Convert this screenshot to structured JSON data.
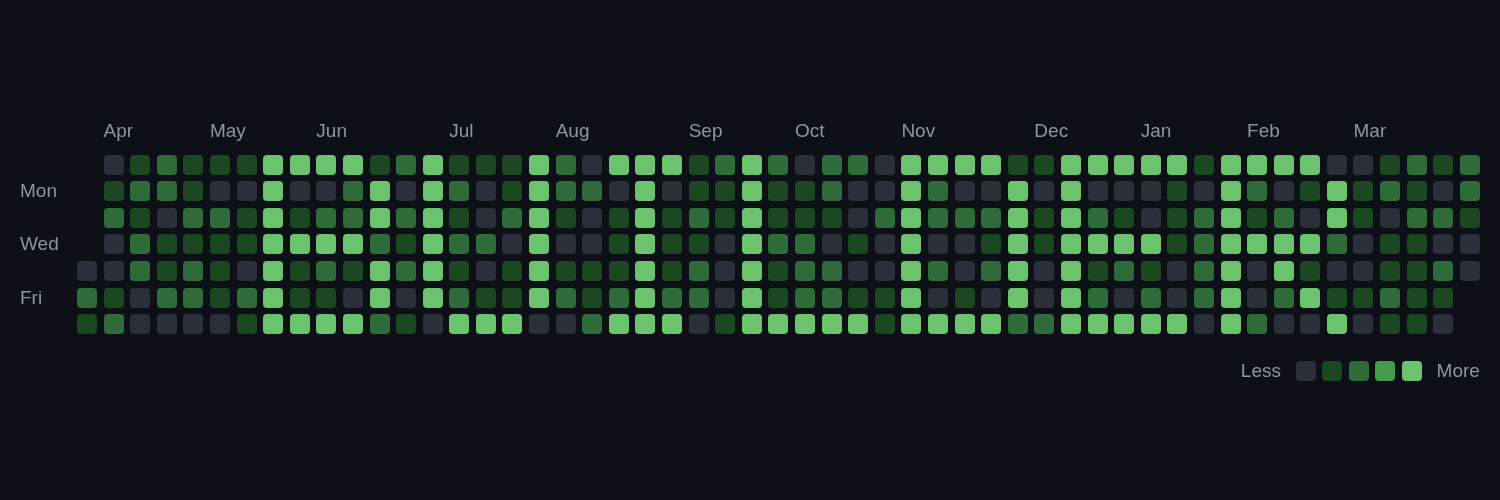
{
  "day_labels": [
    {
      "label": "Mon"
    },
    {
      "label": "Wed"
    },
    {
      "label": "Fri"
    }
  ],
  "weeks": [
    {
      "days": [
        {
          "color": "#2a2f3a"
        },
        {
          "color": "#2e6b38"
        },
        {
          "color": "#1b4721"
        }
      ]
    },
    {
      "month": "Apr",
      "days": [
        {
          "color": "#2a2f3a"
        },
        {
          "color": "#1b4721"
        },
        {
          "color": "#2e6b38"
        },
        {
          "color": "#2a2f3a"
        },
        {
          "color": "#2a2f3a"
        },
        {
          "color": "#1b4721"
        },
        {
          "color": "#2e6b38"
        }
      ]
    },
    {
      "days": [
        {
          "color": "#1b4721"
        },
        {
          "color": "#2e6b38"
        },
        {
          "color": "#1b4721"
        },
        {
          "color": "#2e6b38"
        },
        {
          "color": "#2e6b38"
        },
        {
          "color": "#2a2f3a"
        },
        {
          "color": "#2a2f3a"
        }
      ]
    },
    {
      "days": [
        {
          "color": "#2e6b38"
        },
        {
          "color": "#2e6b38"
        },
        {
          "color": "#2a2f3a"
        },
        {
          "color": "#1b4721"
        },
        {
          "color": "#1b4721"
        },
        {
          "color": "#2e6b38"
        },
        {
          "color": "#2a2f3a"
        }
      ]
    },
    {
      "days": [
        {
          "color": "#1b4721"
        },
        {
          "color": "#1b4721"
        },
        {
          "color": "#2e6b38"
        },
        {
          "color": "#1b4721"
        },
        {
          "color": "#2e6b38"
        },
        {
          "color": "#2e6b38"
        },
        {
          "color": "#2a2f3a"
        }
      ]
    },
    {
      "month": "May",
      "days": [
        {
          "color": "#1b4721"
        },
        {
          "color": "#2a2f3a"
        },
        {
          "color": "#2e6b38"
        },
        {
          "color": "#1b4721"
        },
        {
          "color": "#1b4721"
        },
        {
          "color": "#1b4721"
        },
        {
          "color": "#2a2f3a"
        }
      ]
    },
    {
      "days": [
        {
          "color": "#1b4721"
        },
        {
          "color": "#2a2f3a"
        },
        {
          "color": "#1b4721"
        },
        {
          "color": "#1b4721"
        },
        {
          "color": "#2a2f3a"
        },
        {
          "color": "#2e6b38"
        },
        {
          "color": "#1b4721"
        }
      ]
    },
    {
      "days": [
        {
          "color": "#6bc46d"
        },
        {
          "color": "#6bc46d"
        },
        {
          "color": "#6bc46d"
        },
        {
          "color": "#6bc46d"
        },
        {
          "color": "#6bc46d"
        },
        {
          "color": "#6bc46d"
        },
        {
          "color": "#6bc46d"
        }
      ]
    },
    {
      "days": [
        {
          "color": "#6bc46d"
        },
        {
          "color": "#2a2f3a"
        },
        {
          "color": "#1b4721"
        },
        {
          "color": "#6bc46d"
        },
        {
          "color": "#1b4721"
        },
        {
          "color": "#1b4721"
        },
        {
          "color": "#6bc46d"
        }
      ]
    },
    {
      "month": "Jun",
      "days": [
        {
          "color": "#6bc46d"
        },
        {
          "color": "#2a2f3a"
        },
        {
          "color": "#2e6b38"
        },
        {
          "color": "#6bc46d"
        },
        {
          "color": "#2e6b38"
        },
        {
          "color": "#1b4721"
        },
        {
          "color": "#6bc46d"
        }
      ]
    },
    {
      "days": [
        {
          "color": "#6bc46d"
        },
        {
          "color": "#2e6b38"
        },
        {
          "color": "#2e6b38"
        },
        {
          "color": "#6bc46d"
        },
        {
          "color": "#1b4721"
        },
        {
          "color": "#2a2f3a"
        },
        {
          "color": "#6bc46d"
        }
      ]
    },
    {
      "days": [
        {
          "color": "#1b4721"
        },
        {
          "color": "#6bc46d"
        },
        {
          "color": "#6bc46d"
        },
        {
          "color": "#2e6b38"
        },
        {
          "color": "#6bc46d"
        },
        {
          "color": "#6bc46d"
        },
        {
          "color": "#2e6b38"
        }
      ]
    },
    {
      "days": [
        {
          "color": "#2e6b38"
        },
        {
          "color": "#2a2f3a"
        },
        {
          "color": "#2e6b38"
        },
        {
          "color": "#1b4721"
        },
        {
          "color": "#2e6b38"
        },
        {
          "color": "#2a2f3a"
        },
        {
          "color": "#1b4721"
        }
      ]
    },
    {
      "days": [
        {
          "color": "#6bc46d"
        },
        {
          "color": "#6bc46d"
        },
        {
          "color": "#6bc46d"
        },
        {
          "color": "#6bc46d"
        },
        {
          "color": "#6bc46d"
        },
        {
          "color": "#6bc46d"
        },
        {
          "color": "#2a2f3a"
        }
      ]
    },
    {
      "month": "Jul",
      "days": [
        {
          "color": "#1b4721"
        },
        {
          "color": "#2e6b38"
        },
        {
          "color": "#1b4721"
        },
        {
          "color": "#2e6b38"
        },
        {
          "color": "#1b4721"
        },
        {
          "color": "#2e6b38"
        },
        {
          "color": "#6bc46d"
        }
      ]
    },
    {
      "days": [
        {
          "color": "#1b4721"
        },
        {
          "color": "#2a2f3a"
        },
        {
          "color": "#2a2f3a"
        },
        {
          "color": "#2e6b38"
        },
        {
          "color": "#2a2f3a"
        },
        {
          "color": "#1b4721"
        },
        {
          "color": "#6bc46d"
        }
      ]
    },
    {
      "days": [
        {
          "color": "#1b4721"
        },
        {
          "color": "#1b4721"
        },
        {
          "color": "#2e6b38"
        },
        {
          "color": "#2a2f3a"
        },
        {
          "color": "#1b4721"
        },
        {
          "color": "#1b4721"
        },
        {
          "color": "#6bc46d"
        }
      ]
    },
    {
      "days": [
        {
          "color": "#6bc46d"
        },
        {
          "color": "#6bc46d"
        },
        {
          "color": "#6bc46d"
        },
        {
          "color": "#6bc46d"
        },
        {
          "color": "#6bc46d"
        },
        {
          "color": "#6bc46d"
        },
        {
          "color": "#2a2f3a"
        }
      ]
    },
    {
      "month": "Aug",
      "days": [
        {
          "color": "#2e6b38"
        },
        {
          "color": "#2e6b38"
        },
        {
          "color": "#1b4721"
        },
        {
          "color": "#2a2f3a"
        },
        {
          "color": "#1b4721"
        },
        {
          "color": "#2e6b38"
        },
        {
          "color": "#2a2f3a"
        }
      ]
    },
    {
      "days": [
        {
          "color": "#2a2f3a"
        },
        {
          "color": "#2e6b38"
        },
        {
          "color": "#2a2f3a"
        },
        {
          "color": "#2a2f3a"
        },
        {
          "color": "#1b4721"
        },
        {
          "color": "#1b4721"
        },
        {
          "color": "#2e6b38"
        }
      ]
    },
    {
      "days": [
        {
          "color": "#6bc46d"
        },
        {
          "color": "#2a2f3a"
        },
        {
          "color": "#1b4721"
        },
        {
          "color": "#1b4721"
        },
        {
          "color": "#1b4721"
        },
        {
          "color": "#2e6b38"
        },
        {
          "color": "#6bc46d"
        }
      ]
    },
    {
      "days": [
        {
          "color": "#6bc46d"
        },
        {
          "color": "#6bc46d"
        },
        {
          "color": "#6bc46d"
        },
        {
          "color": "#6bc46d"
        },
        {
          "color": "#6bc46d"
        },
        {
          "color": "#6bc46d"
        },
        {
          "color": "#6bc46d"
        }
      ]
    },
    {
      "days": [
        {
          "color": "#6bc46d"
        },
        {
          "color": "#2a2f3a"
        },
        {
          "color": "#1b4721"
        },
        {
          "color": "#1b4721"
        },
        {
          "color": "#1b4721"
        },
        {
          "color": "#2e6b38"
        },
        {
          "color": "#6bc46d"
        }
      ]
    },
    {
      "month": "Sep",
      "days": [
        {
          "color": "#1b4721"
        },
        {
          "color": "#1b4721"
        },
        {
          "color": "#2e6b38"
        },
        {
          "color": "#1b4721"
        },
        {
          "color": "#2e6b38"
        },
        {
          "color": "#2e6b38"
        },
        {
          "color": "#2a2f3a"
        }
      ]
    },
    {
      "days": [
        {
          "color": "#2e6b38"
        },
        {
          "color": "#1b4721"
        },
        {
          "color": "#1b4721"
        },
        {
          "color": "#2a2f3a"
        },
        {
          "color": "#2a2f3a"
        },
        {
          "color": "#2a2f3a"
        },
        {
          "color": "#1b4721"
        }
      ]
    },
    {
      "days": [
        {
          "color": "#6bc46d"
        },
        {
          "color": "#6bc46d"
        },
        {
          "color": "#6bc46d"
        },
        {
          "color": "#6bc46d"
        },
        {
          "color": "#6bc46d"
        },
        {
          "color": "#6bc46d"
        },
        {
          "color": "#6bc46d"
        }
      ]
    },
    {
      "days": [
        {
          "color": "#2e6b38"
        },
        {
          "color": "#1b4721"
        },
        {
          "color": "#1b4721"
        },
        {
          "color": "#2e6b38"
        },
        {
          "color": "#1b4721"
        },
        {
          "color": "#1b4721"
        },
        {
          "color": "#6bc46d"
        }
      ]
    },
    {
      "month": "Oct",
      "days": [
        {
          "color": "#2a2f3a"
        },
        {
          "color": "#1b4721"
        },
        {
          "color": "#1b4721"
        },
        {
          "color": "#2e6b38"
        },
        {
          "color": "#2e6b38"
        },
        {
          "color": "#2e6b38"
        },
        {
          "color": "#6bc46d"
        }
      ]
    },
    {
      "days": [
        {
          "color": "#2e6b38"
        },
        {
          "color": "#2e6b38"
        },
        {
          "color": "#1b4721"
        },
        {
          "color": "#2a2f3a"
        },
        {
          "color": "#2e6b38"
        },
        {
          "color": "#2e6b38"
        },
        {
          "color": "#6bc46d"
        }
      ]
    },
    {
      "days": [
        {
          "color": "#2e6b38"
        },
        {
          "color": "#2a2f3a"
        },
        {
          "color": "#2a2f3a"
        },
        {
          "color": "#1b4721"
        },
        {
          "color": "#2a2f3a"
        },
        {
          "color": "#1b4721"
        },
        {
          "color": "#6bc46d"
        }
      ]
    },
    {
      "days": [
        {
          "color": "#2a2f3a"
        },
        {
          "color": "#2a2f3a"
        },
        {
          "color": "#2e6b38"
        },
        {
          "color": "#2a2f3a"
        },
        {
          "color": "#2a2f3a"
        },
        {
          "color": "#1b4721"
        },
        {
          "color": "#1b4721"
        }
      ]
    },
    {
      "month": "Nov",
      "days": [
        {
          "color": "#6bc46d"
        },
        {
          "color": "#6bc46d"
        },
        {
          "color": "#6bc46d"
        },
        {
          "color": "#6bc46d"
        },
        {
          "color": "#6bc46d"
        },
        {
          "color": "#6bc46d"
        },
        {
          "color": "#6bc46d"
        }
      ]
    },
    {
      "days": [
        {
          "color": "#6bc46d"
        },
        {
          "color": "#2e6b38"
        },
        {
          "color": "#2e6b38"
        },
        {
          "color": "#2a2f3a"
        },
        {
          "color": "#2e6b38"
        },
        {
          "color": "#2a2f3a"
        },
        {
          "color": "#6bc46d"
        }
      ]
    },
    {
      "days": [
        {
          "color": "#6bc46d"
        },
        {
          "color": "#2a2f3a"
        },
        {
          "color": "#2e6b38"
        },
        {
          "color": "#2a2f3a"
        },
        {
          "color": "#2a2f3a"
        },
        {
          "color": "#1b4721"
        },
        {
          "color": "#6bc46d"
        }
      ]
    },
    {
      "days": [
        {
          "color": "#6bc46d"
        },
        {
          "color": "#2a2f3a"
        },
        {
          "color": "#2e6b38"
        },
        {
          "color": "#1b4721"
        },
        {
          "color": "#2e6b38"
        },
        {
          "color": "#2a2f3a"
        },
        {
          "color": "#6bc46d"
        }
      ]
    },
    {
      "days": [
        {
          "color": "#1b4721"
        },
        {
          "color": "#6bc46d"
        },
        {
          "color": "#6bc46d"
        },
        {
          "color": "#6bc46d"
        },
        {
          "color": "#6bc46d"
        },
        {
          "color": "#6bc46d"
        },
        {
          "color": "#2e6b38"
        }
      ]
    },
    {
      "month": "Dec",
      "days": [
        {
          "color": "#1b4721"
        },
        {
          "color": "#2a2f3a"
        },
        {
          "color": "#1b4721"
        },
        {
          "color": "#1b4721"
        },
        {
          "color": "#2a2f3a"
        },
        {
          "color": "#2a2f3a"
        },
        {
          "color": "#2e6b38"
        }
      ]
    },
    {
      "days": [
        {
          "color": "#6bc46d"
        },
        {
          "color": "#6bc46d"
        },
        {
          "color": "#6bc46d"
        },
        {
          "color": "#6bc46d"
        },
        {
          "color": "#6bc46d"
        },
        {
          "color": "#6bc46d"
        },
        {
          "color": "#6bc46d"
        }
      ]
    },
    {
      "days": [
        {
          "color": "#6bc46d"
        },
        {
          "color": "#2a2f3a"
        },
        {
          "color": "#2e6b38"
        },
        {
          "color": "#6bc46d"
        },
        {
          "color": "#1b4721"
        },
        {
          "color": "#2e6b38"
        },
        {
          "color": "#6bc46d"
        }
      ]
    },
    {
      "days": [
        {
          "color": "#6bc46d"
        },
        {
          "color": "#2a2f3a"
        },
        {
          "color": "#1b4721"
        },
        {
          "color": "#6bc46d"
        },
        {
          "color": "#2e6b38"
        },
        {
          "color": "#2a2f3a"
        },
        {
          "color": "#6bc46d"
        }
      ]
    },
    {
      "month": "Jan",
      "days": [
        {
          "color": "#6bc46d"
        },
        {
          "color": "#2a2f3a"
        },
        {
          "color": "#2a2f3a"
        },
        {
          "color": "#6bc46d"
        },
        {
          "color": "#1b4721"
        },
        {
          "color": "#2e6b38"
        },
        {
          "color": "#6bc46d"
        }
      ]
    },
    {
      "days": [
        {
          "color": "#6bc46d"
        },
        {
          "color": "#1b4721"
        },
        {
          "color": "#1b4721"
        },
        {
          "color": "#1b4721"
        },
        {
          "color": "#2a2f3a"
        },
        {
          "color": "#2a2f3a"
        },
        {
          "color": "#6bc46d"
        }
      ]
    },
    {
      "days": [
        {
          "color": "#1b4721"
        },
        {
          "color": "#2a2f3a"
        },
        {
          "color": "#2e6b38"
        },
        {
          "color": "#2e6b38"
        },
        {
          "color": "#2e6b38"
        },
        {
          "color": "#2e6b38"
        },
        {
          "color": "#2a2f3a"
        }
      ]
    },
    {
      "days": [
        {
          "color": "#6bc46d"
        },
        {
          "color": "#6bc46d"
        },
        {
          "color": "#6bc46d"
        },
        {
          "color": "#6bc46d"
        },
        {
          "color": "#6bc46d"
        },
        {
          "color": "#6bc46d"
        },
        {
          "color": "#6bc46d"
        }
      ]
    },
    {
      "month": "Feb",
      "days": [
        {
          "color": "#6bc46d"
        },
        {
          "color": "#2e6b38"
        },
        {
          "color": "#1b4721"
        },
        {
          "color": "#6bc46d"
        },
        {
          "color": "#2a2f3a"
        },
        {
          "color": "#2a2f3a"
        },
        {
          "color": "#2e6b38"
        }
      ]
    },
    {
      "days": [
        {
          "color": "#6bc46d"
        },
        {
          "color": "#2a2f3a"
        },
        {
          "color": "#2e6b38"
        },
        {
          "color": "#6bc46d"
        },
        {
          "color": "#6bc46d"
        },
        {
          "color": "#2e6b38"
        },
        {
          "color": "#2a2f3a"
        }
      ]
    },
    {
      "days": [
        {
          "color": "#6bc46d"
        },
        {
          "color": "#1b4721"
        },
        {
          "color": "#2a2f3a"
        },
        {
          "color": "#6bc46d"
        },
        {
          "color": "#1b4721"
        },
        {
          "color": "#6bc46d"
        },
        {
          "color": "#2a2f3a"
        }
      ]
    },
    {
      "days": [
        {
          "color": "#2a2f3a"
        },
        {
          "color": "#6bc46d"
        },
        {
          "color": "#6bc46d"
        },
        {
          "color": "#2e6b38"
        },
        {
          "color": "#2a2f3a"
        },
        {
          "color": "#1b4721"
        },
        {
          "color": "#6bc46d"
        }
      ]
    },
    {
      "month": "Mar",
      "days": [
        {
          "color": "#2a2f3a"
        },
        {
          "color": "#1b4721"
        },
        {
          "color": "#1b4721"
        },
        {
          "color": "#2a2f3a"
        },
        {
          "color": "#2a2f3a"
        },
        {
          "color": "#1b4721"
        },
        {
          "color": "#2a2f3a"
        }
      ]
    },
    {
      "days": [
        {
          "color": "#1b4721"
        },
        {
          "color": "#2e6b38"
        },
        {
          "color": "#2a2f3a"
        },
        {
          "color": "#1b4721"
        },
        {
          "color": "#1b4721"
        },
        {
          "color": "#2e6b38"
        },
        {
          "color": "#1b4721"
        }
      ]
    },
    {
      "days": [
        {
          "color": "#2e6b38"
        },
        {
          "color": "#1b4721"
        },
        {
          "color": "#2e6b38"
        },
        {
          "color": "#1b4721"
        },
        {
          "color": "#1b4721"
        },
        {
          "color": "#1b4721"
        },
        {
          "color": "#1b4721"
        }
      ]
    },
    {
      "days": [
        {
          "color": "#1b4721"
        },
        {
          "color": "#2a2f3a"
        },
        {
          "color": "#2e6b38"
        },
        {
          "color": "#2a2f3a"
        },
        {
          "color": "#2e6b38"
        },
        {
          "color": "#1b4721"
        },
        {
          "color": "#2a2f3a"
        }
      ]
    },
    {
      "days": [
        {
          "color": "#2e6b38"
        },
        {
          "color": "#2e6b38"
        },
        {
          "color": "#1b4721"
        },
        {
          "color": "#2a2f3a"
        },
        {
          "color": "#2a2f3a"
        }
      ]
    }
  ],
  "legend": {
    "less": "Less",
    "more": "More",
    "swatches": [
      {
        "color": "#2a2f3a"
      },
      {
        "color": "#1b4721"
      },
      {
        "color": "#2e6b38"
      },
      {
        "color": "#449b4c"
      },
      {
        "color": "#6bc46d"
      }
    ]
  }
}
